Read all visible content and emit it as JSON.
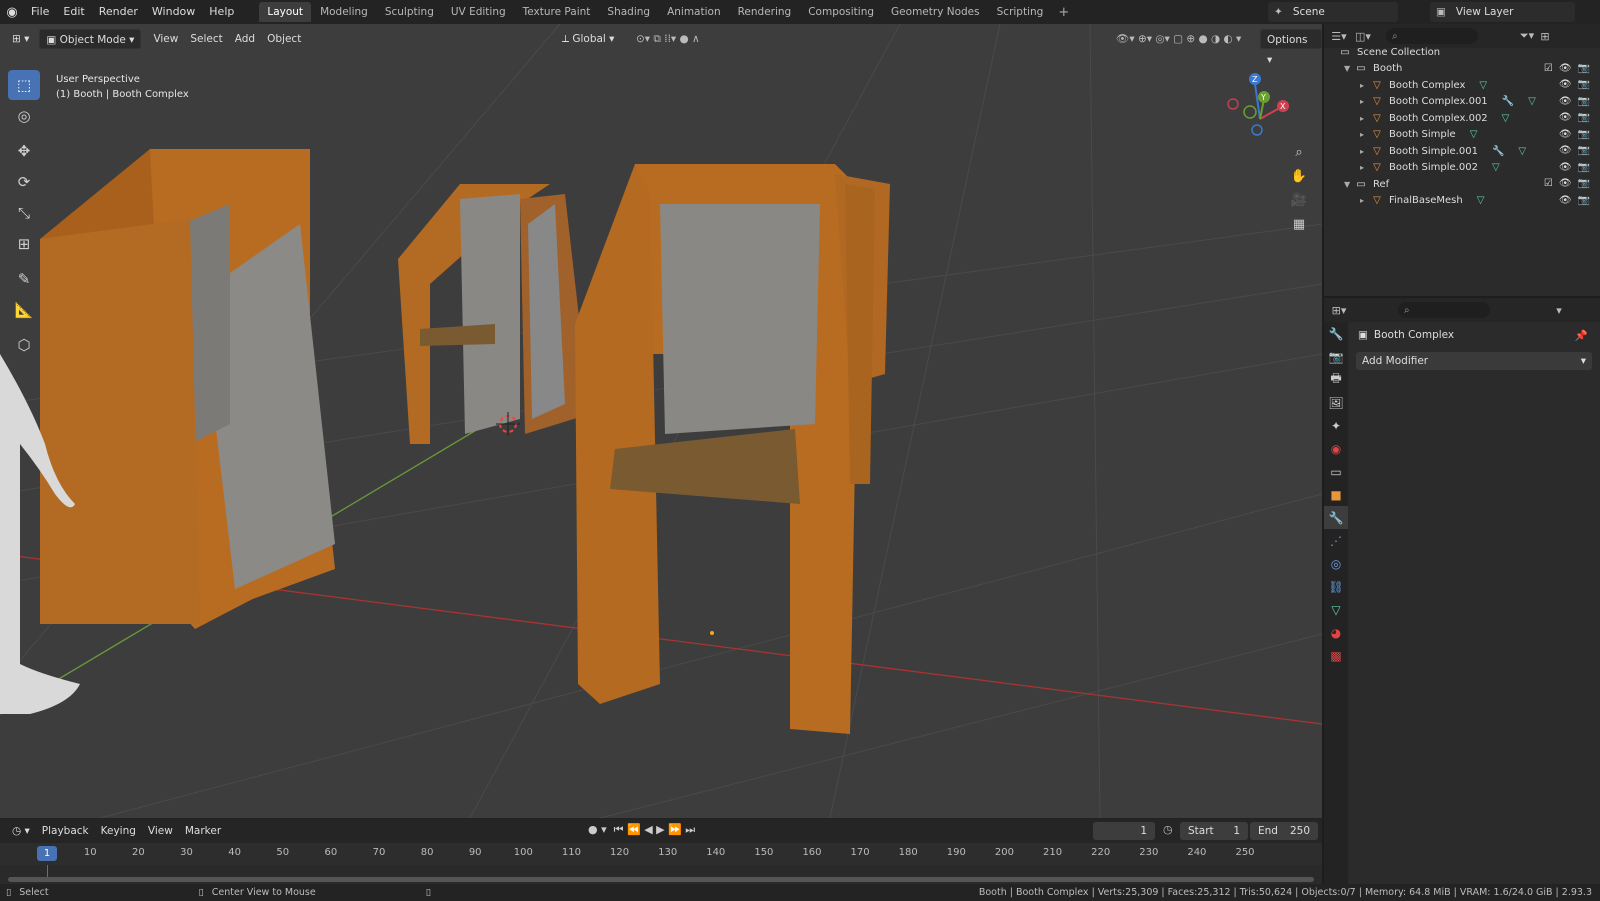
{
  "topbar": {
    "menus": [
      "File",
      "Edit",
      "Render",
      "Window",
      "Help"
    ],
    "workspaces": [
      "Layout",
      "Modeling",
      "Sculpting",
      "UV Editing",
      "Texture Paint",
      "Shading",
      "Animation",
      "Rendering",
      "Compositing",
      "Geometry Nodes",
      "Scripting"
    ],
    "active_workspace": "Layout",
    "scene": "Scene",
    "view_layer": "View Layer"
  },
  "viewport": {
    "mode": "Object Mode",
    "menus": [
      "View",
      "Select",
      "Add",
      "Object"
    ],
    "orientation": "Global",
    "options": "Options",
    "perspective_label": "User Perspective",
    "object_label": "(1) Booth | Booth Complex"
  },
  "outliner": {
    "root": "Scene Collection",
    "collections": [
      {
        "name": "Booth",
        "items": [
          "Booth Complex",
          "Booth Complex.001",
          "Booth Complex.002",
          "Booth Simple",
          "Booth Simple.001",
          "Booth Simple.002"
        ]
      },
      {
        "name": "Ref",
        "items": [
          "FinalBaseMesh"
        ]
      }
    ]
  },
  "properties": {
    "object_name": "Booth Complex",
    "add_modifier": "Add Modifier"
  },
  "timeline": {
    "menus": [
      "Playback",
      "Keying",
      "View",
      "Marker"
    ],
    "current_frame": "1",
    "start_label": "Start",
    "start": "1",
    "end_label": "End",
    "end": "250",
    "ticks": [
      "1",
      "10",
      "20",
      "30",
      "40",
      "50",
      "60",
      "70",
      "80",
      "90",
      "100",
      "110",
      "120",
      "130",
      "140",
      "150",
      "160",
      "170",
      "180",
      "190",
      "200",
      "210",
      "220",
      "230",
      "240",
      "250"
    ]
  },
  "status": {
    "left_action": "Select",
    "mid_action": "Center View to Mouse",
    "stats": "Booth | Booth Complex | Verts:25,309 | Faces:25,312 | Tris:50,624 | Objects:0/7 | Memory: 64.8 MiB | VRAM: 1.6/24.0 GiB | 2.93.3"
  }
}
